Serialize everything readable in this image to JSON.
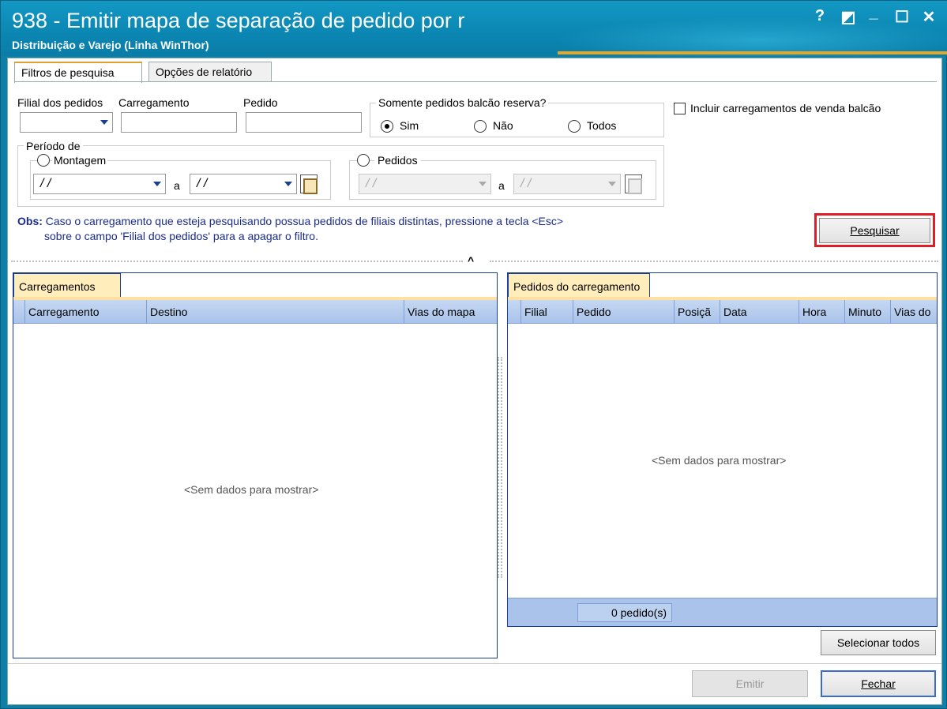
{
  "window": {
    "title": "938 - Emitir mapa de separação de pedido por r",
    "subtitle": "Distribuição e Varejo (Linha WinThor)",
    "controls": [
      "?",
      "◩",
      "_",
      "☐",
      "✕"
    ]
  },
  "tabs": [
    {
      "label": "Filtros de pesquisa",
      "active": true
    },
    {
      "label": "Opções de relatório",
      "active": false
    }
  ],
  "filters": {
    "filial_label": "Filial dos pedidos",
    "filial_value": "",
    "carregamento_label": "Carregamento",
    "carregamento_value": "",
    "pedido_label": "Pedido",
    "pedido_value": "",
    "balcao_label": "Somente pedidos balcão reserva?",
    "balcao_options": [
      "Sim",
      "Não",
      "Todos"
    ],
    "balcao_selected": "Sim",
    "incluir_label": "Incluir carregamentos de venda balcão",
    "incluir_checked": false,
    "periodo_label": "Período de",
    "montagem_label": "Montagem",
    "pedidos_label": "Pedidos",
    "date_placeholder": "/ /",
    "a_label": "a"
  },
  "obs": {
    "prefix": "Obs:",
    "line1": "Caso o carregamento que esteja pesquisando possua pedidos de filiais distintas, pressione a tecla <Esc>",
    "line2": "sobre o campo 'Filial dos pedidos' para a apagar o filtro."
  },
  "buttons": {
    "pesquisar": "Pesquisar",
    "selecionar_todos": "Selecionar todos",
    "emitir": "Emitir",
    "fechar": "Fechar"
  },
  "left_panel": {
    "tab": "Carregamentos",
    "columns": [
      "Carregamento",
      "Destino",
      "Vias do mapa"
    ],
    "empty": "<Sem dados para mostrar>"
  },
  "right_panel": {
    "tab": "Pedidos do carregamento",
    "columns": [
      "Filial",
      "Pedido",
      "Posiçã",
      "Data",
      "Hora",
      "Minuto",
      "Vias do"
    ],
    "empty": "<Sem dados para mostrar>",
    "footer_count": "0 pedido(s)"
  },
  "colors": {
    "titlebar": "#0b86b2",
    "accent_orange": "#e8a626",
    "highlight_red": "#e01c24",
    "grid_header": "#a9c3ea"
  }
}
